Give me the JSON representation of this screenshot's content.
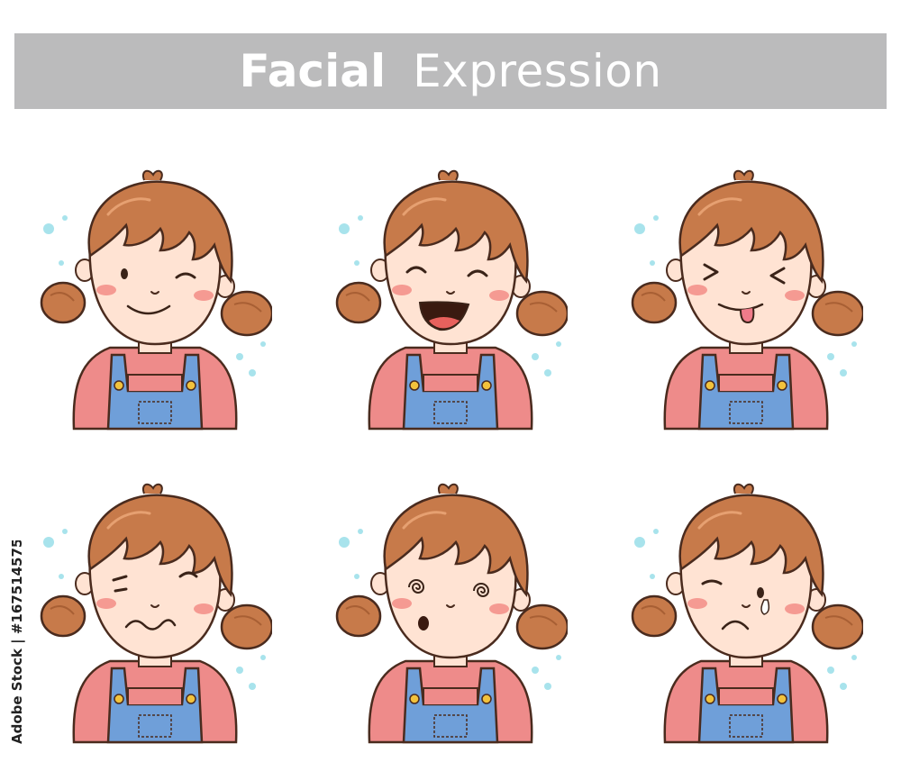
{
  "header": {
    "title_bold": "Facial",
    "title_light": "Expression"
  },
  "watermark": {
    "stock_id_text": "Adobe Stock | #167514575"
  },
  "expressions": [
    {
      "name": "winking"
    },
    {
      "name": "laughing"
    },
    {
      "name": "tongue-out"
    },
    {
      "name": "confused"
    },
    {
      "name": "dizzy"
    },
    {
      "name": "crying"
    }
  ],
  "colors": {
    "banner": "#bbbbbc",
    "hair": "#c77a4a",
    "hair_shade": "#a85f34",
    "skin": "#ffe3d3",
    "blush": "#f59a92",
    "shirt": "#ee8b8a",
    "overalls": "#6f9fd9",
    "buttons": "#f2c23c",
    "outline": "#4a2b1e",
    "dots": "#a8e3ec"
  }
}
